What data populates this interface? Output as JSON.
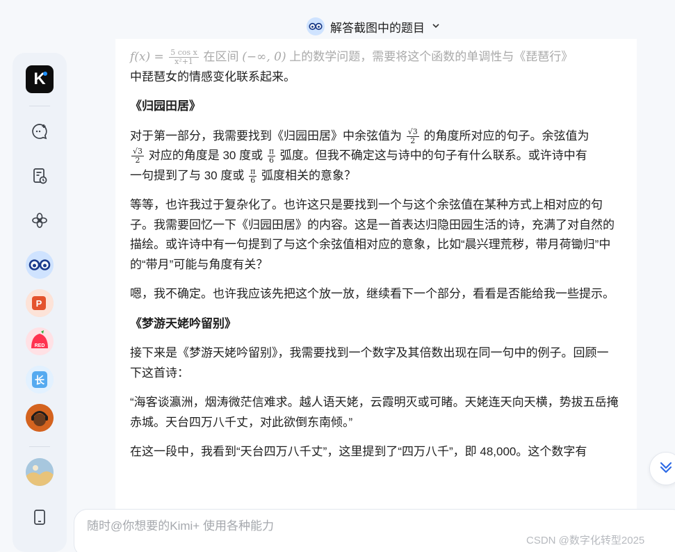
{
  "header": {
    "title": "解答截图中的题目",
    "dropdown_icon": "chevron-down-icon"
  },
  "sidebar": {
    "logo_letter": "K",
    "items": [
      {
        "name": "new-chat-icon"
      },
      {
        "name": "history-icon"
      },
      {
        "name": "explore-icon"
      }
    ],
    "apps": [
      {
        "name": "glasses-app",
        "color": "#2f6fe0"
      },
      {
        "name": "ppt-app",
        "label": "P",
        "color": "#e85a36"
      },
      {
        "name": "red-app",
        "label": "RED",
        "color": "#ff3b4f"
      },
      {
        "name": "long-text-app",
        "label": "长",
        "color": "#4da3f5"
      },
      {
        "name": "music-app",
        "color": "#d45d1e"
      }
    ],
    "bottom": [
      {
        "name": "profile-avatar"
      },
      {
        "name": "mobile-icon"
      }
    ]
  },
  "content": {
    "intro_formula_left": "f(x) = ",
    "intro_frac_num": "5 cos x",
    "intro_frac_den": "x²+1",
    "intro_text_1": " 在区间 ",
    "intro_interval": "(−∞, 0)",
    "intro_text_2": " 上的数学问题，需要将这个函数的单调性与《琵琶行》",
    "intro_text_3": "中琵琶女的情感变化联系起来。",
    "heading_1": "《归园田居》",
    "p1_a": "对于第一部分，我需要找到《归园田居》中余弦值为 ",
    "frac_sqrt3_num": "√3",
    "frac_sqrt3_den": "2",
    "p1_b": " 的角度所对应的句子。余弦值为",
    "p1_c": " 对应的角度是 30 度或 ",
    "frac_pi_num": "π",
    "frac_pi_den": "6",
    "p1_d": " 弧度。但我不确定这与诗中的句子有什么联系。或许诗中有",
    "p1_e": "一句提到了与 30 度或 ",
    "p1_f": " 弧度相关的意象？",
    "p2": "等等，也许我过于复杂化了。也许这只是要找到一个与这个余弦值在某种方式上相对应的句子。我需要回忆一下《归园田居》的内容。这是一首表达归隐田园生活的诗，充满了对自然的描绘。或许诗中有一句提到了与这个余弦值相对应的意象，比如“晨兴理荒秽，带月荷锄归”中的“带月”可能与角度有关？",
    "p3": "嗯，我不确定。也许我应该先把这个放一放，继续看下一个部分，看看是否能给我一些提示。",
    "heading_2": "《梦游天姥吟留别》",
    "p4": "接下来是《梦游天姥吟留别》，我需要找到一个数字及其倍数出现在同一句中的例子。回顾一下这首诗：",
    "p5": "“海客谈瀛洲，烟涛微茫信难求。越人语天姥，云霞明灭或可睹。天姥连天向天横，势拔五岳掩赤城。天台四万八千丈，对此欲倒东南倾。”",
    "p6": "在这一段中，我看到“天台四万八千丈”，这里提到了“四万八千”，即 48,000。这个数字有"
  },
  "input": {
    "placeholder": "随时@你想要的Kimi+ 使用各种能力"
  },
  "watermark": "CSDN @数字化转型2025",
  "scroll_button": {
    "icon": "double-chevron-down-icon"
  }
}
